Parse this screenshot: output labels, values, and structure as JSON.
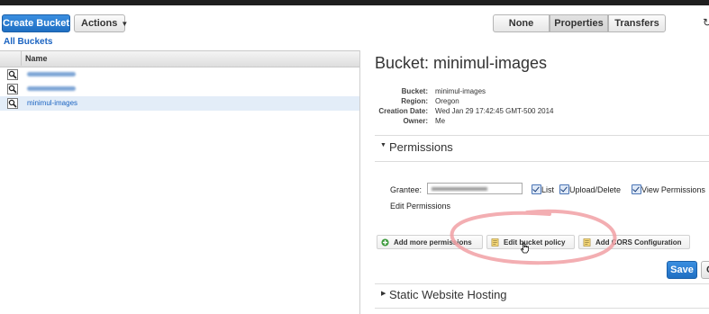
{
  "toolbar": {
    "create_bucket": "Create Bucket",
    "actions": "Actions",
    "views": [
      "None",
      "Properties",
      "Transfers"
    ],
    "active_view": "Properties",
    "all_buckets": "All Buckets"
  },
  "bucket_list": {
    "column_name": "Name",
    "rows": [
      {
        "name": "",
        "obscured": true,
        "selected": false
      },
      {
        "name": "",
        "obscured": true,
        "selected": false
      },
      {
        "name": "minimul-images",
        "obscured": false,
        "selected": true
      }
    ]
  },
  "properties": {
    "title": "Bucket: minimul-images",
    "fields": [
      {
        "label": "Bucket:",
        "value": "minimul-images"
      },
      {
        "label": "Region:",
        "value": "Oregon"
      },
      {
        "label": "Creation Date:",
        "value": "Wed Jan 29 17:42:45 GMT-500 2014"
      },
      {
        "label": "Owner:",
        "value": "Me"
      }
    ],
    "permissions": {
      "heading": "Permissions",
      "expanded": true,
      "grantee_label": "Grantee:",
      "grantee_value": "",
      "checkboxes": [
        {
          "label": "List",
          "checked": true
        },
        {
          "label": "Upload/Delete",
          "checked": true
        },
        {
          "label": "View Permissions",
          "checked": true
        }
      ],
      "edit_permissions": "Edit Permissions",
      "add_more_permissions": "Add more permissions",
      "edit_bucket_policy": "Edit bucket policy",
      "add_cors": "Add CORS Configuration",
      "save": "Save",
      "cancel": "C"
    },
    "static_website": {
      "heading": "Static Website Hosting",
      "expanded": false
    }
  },
  "colors": {
    "accent": "#1f6fc3",
    "link": "#1a63c1",
    "selected_row": "#e3edf8",
    "annotation": "#f1a0a4"
  }
}
